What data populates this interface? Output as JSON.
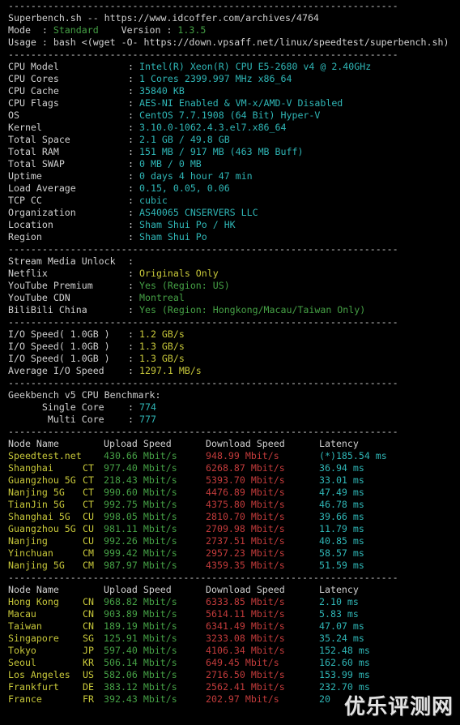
{
  "header": {
    "title": "Superbench.sh -- https://www.idcoffer.com/archives/4764",
    "mode_label": "Mode  : ",
    "mode_value": "Standard",
    "version_label": "    Version : ",
    "version_value": "1.3.5",
    "usage": "Usage : bash <(wget -O- https://down.vpsaff.net/linux/speedtest/superbench.sh)"
  },
  "separator": "---------------------------------------------------------------------",
  "system_info": [
    {
      "key": "CPU Model",
      "value": "Intel(R) Xeon(R) CPU E5-2680 v4 @ 2.40GHz"
    },
    {
      "key": "CPU Cores",
      "value": "1 Cores 2399.997 MHz x86_64"
    },
    {
      "key": "CPU Cache",
      "value": "35840 KB"
    },
    {
      "key": "CPU Flags",
      "value": "AES-NI Enabled & VM-x/AMD-V Disabled"
    },
    {
      "key": "OS",
      "value": "CentOS 7.7.1908 (64 Bit) Hyper-V"
    },
    {
      "key": "Kernel",
      "value": "3.10.0-1062.4.3.el7.x86_64"
    },
    {
      "key": "Total Space",
      "value": "2.1 GB / 49.8 GB"
    },
    {
      "key": "Total RAM",
      "value": "151 MB / 917 MB (463 MB Buff)"
    },
    {
      "key": "Total SWAP",
      "value": "0 MB / 0 MB"
    },
    {
      "key": "Uptime",
      "value": "0 days 4 hour 47 min"
    },
    {
      "key": "Load Average",
      "value": "0.15, 0.05, 0.06"
    },
    {
      "key": "TCP CC",
      "value": "cubic"
    },
    {
      "key": "Organization",
      "value": "AS40065 CNSERVERS LLC"
    },
    {
      "key": "Location",
      "value": "Sham Shui Po / HK"
    },
    {
      "key": "Region",
      "value": "Sham Shui Po"
    }
  ],
  "stream_media": {
    "title": "Stream Media Unlock",
    "items": [
      {
        "key": "Netflix",
        "value": "Originals Only",
        "color": "#c8c83a"
      },
      {
        "key": "YouTube Premium",
        "value": "Yes (Region: US)",
        "color": "#45a045"
      },
      {
        "key": "YouTube CDN",
        "value": "Montreal",
        "color": "#45a045"
      },
      {
        "key": "BiliBili China",
        "value": "Yes (Region: Hongkong/Macau/Taiwan Only)",
        "color": "#45a045"
      }
    ]
  },
  "io_speed": [
    {
      "key": "I/O Speed( 1.0GB )",
      "value": "1.2 GB/s"
    },
    {
      "key": "I/O Speed( 1.0GB )",
      "value": "1.3 GB/s"
    },
    {
      "key": "I/O Speed( 1.0GB )",
      "value": "1.3 GB/s"
    },
    {
      "key": "Average I/O Speed",
      "value": "1297.1 MB/s"
    }
  ],
  "geekbench": {
    "title": "Geekbench v5 CPU Benchmark:",
    "single_label": "      Single Core",
    "single_value": "774",
    "multi_label": "       Multi Core",
    "multi_value": "777"
  },
  "speedtest_cn": {
    "headers": {
      "name": "Node Name",
      "upload": "Upload Speed",
      "download": "Download Speed",
      "latency": "Latency"
    },
    "rows": [
      {
        "name": "Speedtest.net",
        "isp": "",
        "upload": "430.66 Mbit/s",
        "download": "948.99 Mbit/s",
        "latency": "(*)185.54 ms"
      },
      {
        "name": "Shanghai",
        "isp": "CT",
        "upload": "977.40 Mbit/s",
        "download": "6268.87 Mbit/s",
        "latency": "36.94 ms"
      },
      {
        "name": "Guangzhou 5G",
        "isp": "CT",
        "upload": "218.43 Mbit/s",
        "download": "5393.70 Mbit/s",
        "latency": "33.01 ms"
      },
      {
        "name": "Nanjing 5G",
        "isp": "CT",
        "upload": "990.60 Mbit/s",
        "download": "4476.89 Mbit/s",
        "latency": "47.49 ms"
      },
      {
        "name": "TianJin 5G",
        "isp": "CT",
        "upload": "992.75 Mbit/s",
        "download": "4375.80 Mbit/s",
        "latency": "46.78 ms"
      },
      {
        "name": "Shanghai 5G",
        "isp": "CU",
        "upload": "998.05 Mbit/s",
        "download": "2810.70 Mbit/s",
        "latency": "39.66 ms"
      },
      {
        "name": "Guangzhou 5G",
        "isp": "CU",
        "upload": "981.11 Mbit/s",
        "download": "2709.98 Mbit/s",
        "latency": "11.79 ms"
      },
      {
        "name": "Nanjing",
        "isp": "CU",
        "upload": "992.26 Mbit/s",
        "download": "2737.51 Mbit/s",
        "latency": "40.85 ms"
      },
      {
        "name": "Yinchuan",
        "isp": "CM",
        "upload": "999.42 Mbit/s",
        "download": "2957.23 Mbit/s",
        "latency": "58.57 ms"
      },
      {
        "name": "Nanjing 5G",
        "isp": "CM",
        "upload": "987.97 Mbit/s",
        "download": "4359.35 Mbit/s",
        "latency": "51.59 ms"
      }
    ]
  },
  "speedtest_global": {
    "headers": {
      "name": "Node Name",
      "upload": "Upload Speed",
      "download": "Download Speed",
      "latency": "Latency"
    },
    "rows": [
      {
        "name": "Hong Kong",
        "isp": "CN",
        "upload": "968.82 Mbit/s",
        "download": "6333.85 Mbit/s",
        "latency": "2.10 ms"
      },
      {
        "name": "Macau",
        "isp": "CN",
        "upload": "903.89 Mbit/s",
        "download": "5614.11 Mbit/s",
        "latency": "5.83 ms"
      },
      {
        "name": "Taiwan",
        "isp": "CN",
        "upload": "189.19 Mbit/s",
        "download": "6341.49 Mbit/s",
        "latency": "47.07 ms"
      },
      {
        "name": "Singapore",
        "isp": "SG",
        "upload": "125.91 Mbit/s",
        "download": "3233.08 Mbit/s",
        "latency": "35.24 ms"
      },
      {
        "name": "Tokyo",
        "isp": "JP",
        "upload": "597.40 Mbit/s",
        "download": "4106.34 Mbit/s",
        "latency": "152.48 ms"
      },
      {
        "name": "Seoul",
        "isp": "KR",
        "upload": "506.14 Mbit/s",
        "download": "649.45 Mbit/s",
        "latency": "162.60 ms"
      },
      {
        "name": "Los Angeles",
        "isp": "US",
        "upload": "582.06 Mbit/s",
        "download": "2716.50 Mbit/s",
        "latency": "153.99 ms"
      },
      {
        "name": "Frankfurt",
        "isp": "DE",
        "upload": "383.12 Mbit/s",
        "download": "2562.41 Mbit/s",
        "latency": "232.70 ms"
      },
      {
        "name": "France",
        "isp": "FR",
        "upload": "392.43 Mbit/s",
        "download": "202.97 Mbit/s",
        "latency": "20"
      }
    ]
  },
  "watermark": "优乐评测网",
  "colors": {
    "background": "#000000",
    "text": "#d0d0d0",
    "cyan": "#2fb6b6",
    "yellow": "#c8c83a",
    "green": "#45a045",
    "red": "#c23b3b"
  }
}
